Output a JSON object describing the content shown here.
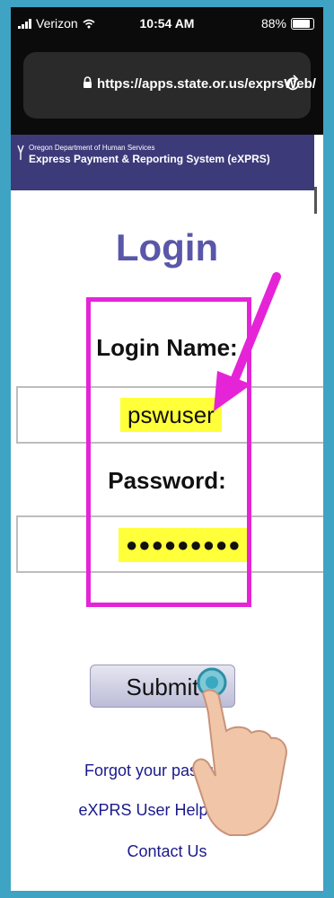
{
  "status_bar": {
    "carrier": "Verizon",
    "time": "10:54 AM",
    "battery": "88%"
  },
  "browser": {
    "url": "https://apps.state.or.us/exprsWeb/"
  },
  "banner": {
    "department": "Oregon Department of Human Services",
    "system": "Express Payment & Reporting System (eXPRS)"
  },
  "login": {
    "title": "Login",
    "name_label": "Login Name:",
    "name_value": "pswuser",
    "password_label": "Password:",
    "password_value": "●●●●●●●●●",
    "submit_label": "Submit"
  },
  "links": {
    "forgot": "Forgot your password?",
    "help": "eXPRS User Help Guide",
    "contact": "Contact Us"
  },
  "colors": {
    "annotation": "#e524d8",
    "highlight": "#ffff3a",
    "title": "#5a56a8",
    "banner": "#3d3a7a"
  }
}
